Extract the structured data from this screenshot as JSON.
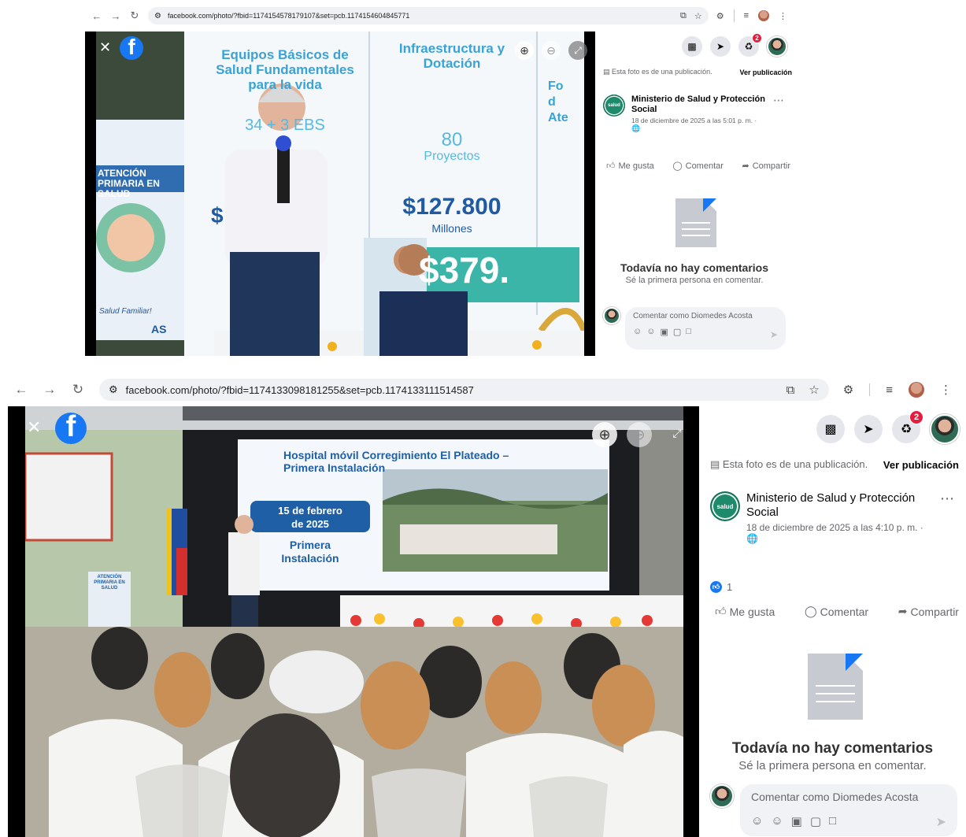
{
  "shot1": {
    "url": "facebook.com/photo/?fbid=1174154578179107&set=pcb.1174154604845771",
    "notifications_badge": "2",
    "publication_note": "Esta foto es de una publicación.",
    "view_post": "Ver publicación",
    "author": "Ministerio de Salud y Protección Social",
    "timestamp": "18 de diciembre de 2025 a las 5:01 p. m. ·",
    "like": "Me gusta",
    "comment": "Comentar",
    "share": "Compartir",
    "no_comments_title": "Todavía no hay comentarios",
    "no_comments_sub": "Sé la primera persona en comentar.",
    "comment_placeholder": "Comentar como Diomedes Acosta",
    "photo_text": {
      "col1": "Equipos Básicos de Salud Fundamentales para la vida",
      "col1_num": "34 + 3 EBS",
      "col1_money": "$",
      "col2": "Infraestructura y Dotación",
      "col2_num": "80",
      "col2_unit": "Proyectos",
      "col2_money": "$127.800",
      "col2_money_unit": "Millones",
      "col3": "Fo d Ate",
      "big_total": "$379.",
      "banner_left": "ATENCIÓN PRIMARIA EN SALUD",
      "banner_left_2": "Salud Familiar!",
      "banner_logo": "AS"
    }
  },
  "shot2": {
    "url": "facebook.com/photo/?fbid=1174133098181255&set=pcb.1174133111514587",
    "notifications_badge": "2",
    "publication_note": "Esta foto es de una publicación.",
    "view_post": "Ver publicación",
    "author": "Ministerio de Salud y Protección Social",
    "timestamp": "18 de diciembre de 2025 a las 4:10 p. m. ·",
    "reactions_count": "1",
    "like": "Me gusta",
    "comment": "Comentar",
    "share": "Compartir",
    "no_comments_title": "Todavía no hay comentarios",
    "no_comments_sub": "Sé la primera persona en comentar.",
    "comment_placeholder": "Comentar como Diomedes Acosta",
    "photo_text": {
      "screen_title": "Hospital móvil Corregimiento El Plateado – Primera Instalación",
      "date_line1": "15 de febrero",
      "date_line2": "de 2025",
      "install_line1": "Primera",
      "install_line2": "Instalación",
      "banner": "ATENCIÓN PRIMARIA EN SALUD"
    }
  },
  "icons": {
    "back": "arrow-left-icon",
    "forward": "arrow-right-icon",
    "reload": "reload-icon",
    "site_info": "tune-icon",
    "close": "close-icon",
    "zoom_in": "zoom-in-icon",
    "zoom_out": "zoom-out-icon",
    "expand": "expand-icon",
    "menu_grid": "grid-icon",
    "messenger": "messenger-icon",
    "bell": "bell-icon",
    "more": "more-icon",
    "like": "thumb-up-icon",
    "comment": "comment-icon",
    "share": "share-icon",
    "send": "send-icon"
  },
  "colors": {
    "facebook_blue": "#1877f2",
    "badge_red": "#e41e3f",
    "panel_bg": "#ffffff",
    "input_bg": "#f0f2f5"
  }
}
